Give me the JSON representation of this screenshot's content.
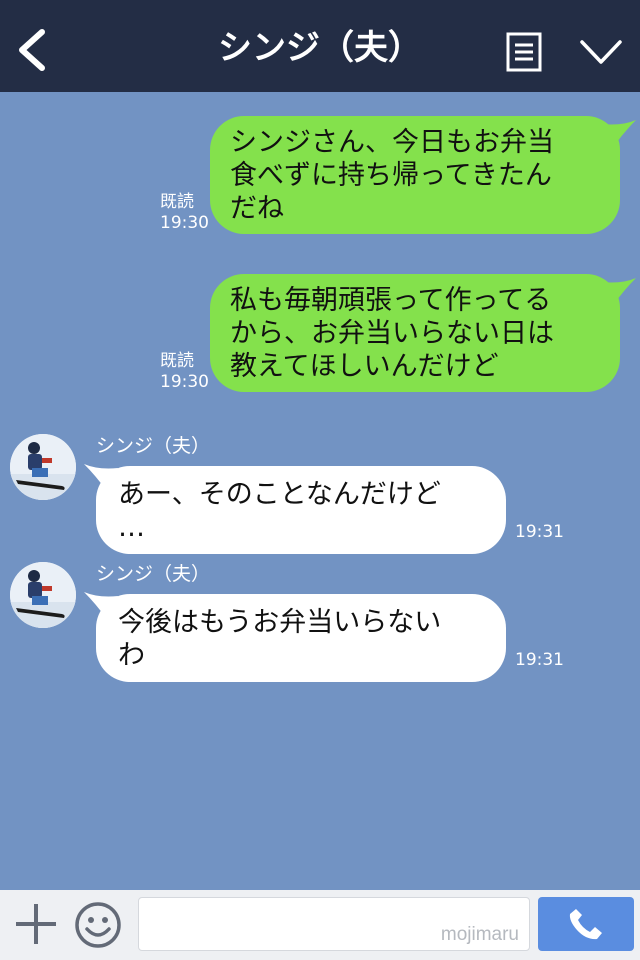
{
  "header": {
    "title": "シンジ（夫）",
    "icons": {
      "back": "back-icon",
      "menu": "menu-icon",
      "expand": "chevron-down-icon"
    }
  },
  "messages": [
    {
      "direction": "outgoing",
      "lines": [
        "シンジさん、今日もお弁当",
        "食べずに持ち帰ってきたん",
        "だね"
      ],
      "read": "既読",
      "time": "19:30"
    },
    {
      "direction": "outgoing",
      "lines": [
        "私も毎朝頑張って作ってる",
        "から、お弁当いらない日は",
        "教えてほしいんだけど"
      ],
      "read": "既読",
      "time": "19:30"
    },
    {
      "direction": "incoming",
      "sender": "シンジ（夫）",
      "lines": [
        "あー、そのことなんだけど",
        "…"
      ],
      "time": "19:31"
    },
    {
      "direction": "incoming",
      "sender": "シンジ（夫）",
      "lines": [
        "今後はもうお弁当いらない",
        "わ"
      ],
      "time": "19:31"
    }
  ],
  "footer": {
    "input_value": "",
    "watermark": "mojimaru",
    "icons": {
      "add": "plus-icon",
      "emoji": "emoji-icon",
      "call": "phone-icon"
    }
  },
  "colors": {
    "header_bg": "#232d45",
    "chat_bg": "#7293c3",
    "outgoing_bubble": "#84e14c",
    "incoming_bubble": "#ffffff",
    "call_button": "#5a8de0"
  }
}
